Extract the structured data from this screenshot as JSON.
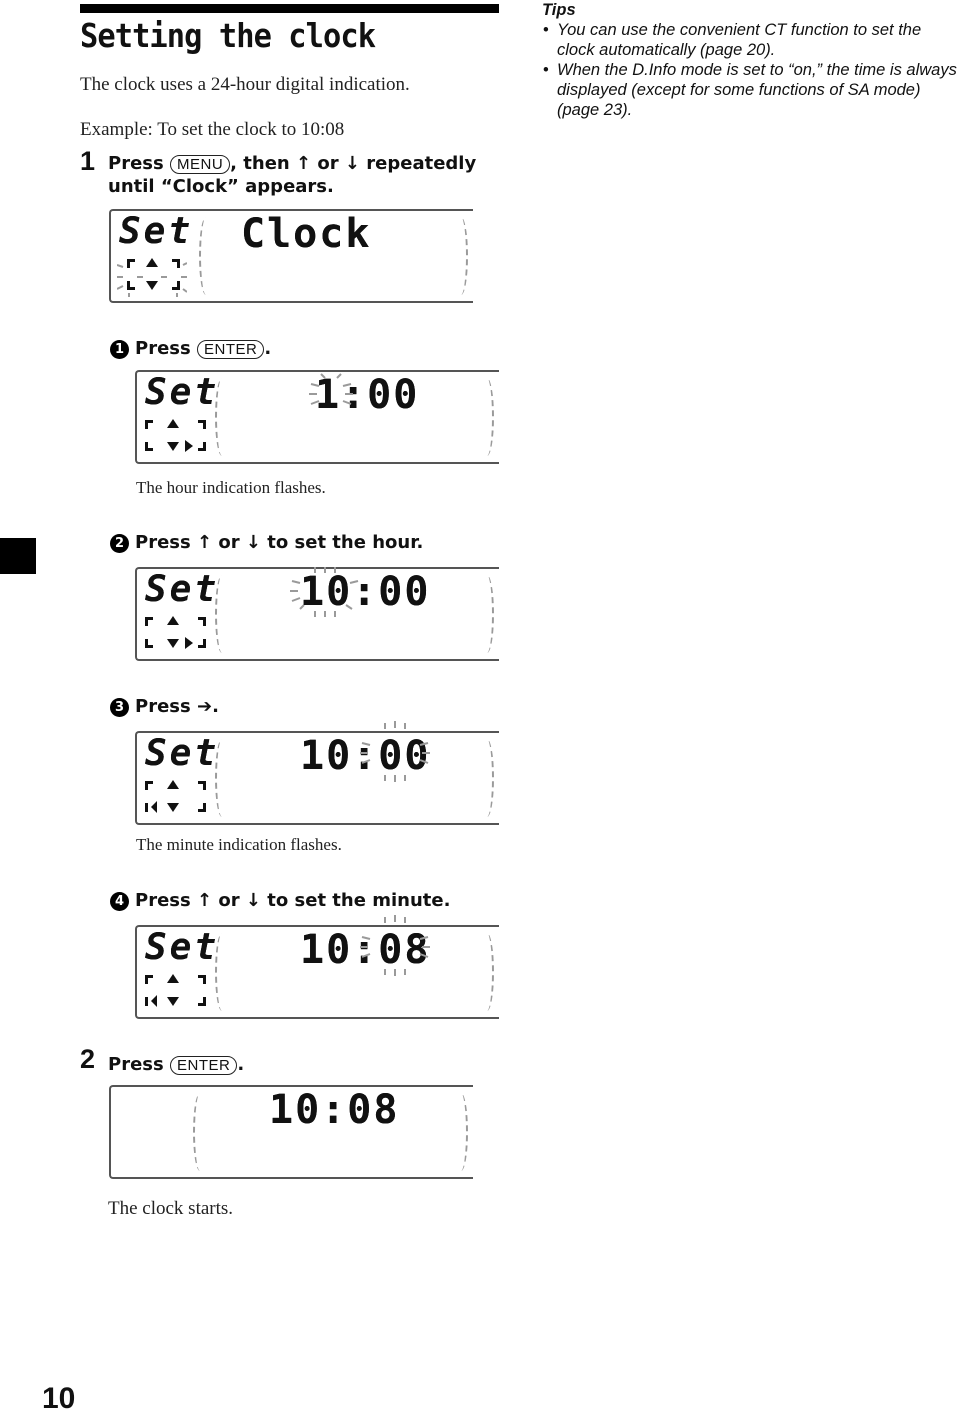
{
  "page": {
    "title": "Setting the clock",
    "intro": "The clock uses a 24-hour digital indication.",
    "example": "Example: To set the clock to 10:08",
    "page_number": "10"
  },
  "tips": {
    "title": "Tips",
    "items": [
      "You can use the convenient CT function to set the clock automatically (page 20).",
      "When the D.Info mode is set to “on,” the time is always displayed (except for some functions of SA mode) (page 23)."
    ]
  },
  "step1": {
    "number": "1",
    "press": "Press",
    "key": "MENU",
    "then": ", then",
    "up_arrow": "↑",
    "or": "or",
    "down_arrow": "↓",
    "rest": "repeatedly",
    "line2": "until “Clock” appears.",
    "display": {
      "left": "Set",
      "main": "Clock",
      "flashing": "cursor-icon"
    }
  },
  "substeps": [
    {
      "marker": "1",
      "text_before": "Press",
      "key": "ENTER",
      "text_after": ".",
      "display": {
        "left": "Set",
        "main": "1:00",
        "flashing": "hour"
      },
      "note": "The hour indication flashes."
    },
    {
      "marker": "2",
      "text_before": "Press",
      "up_arrow": "↑",
      "or": "or",
      "down_arrow": "↓",
      "text_after": "to set the hour.",
      "display": {
        "left": "Set",
        "main": "10:00",
        "flashing": "hour"
      },
      "note": ""
    },
    {
      "marker": "3",
      "text_before": "Press",
      "right_arrow": "➔",
      "text_after": ".",
      "display": {
        "left": "Set",
        "main": "10:00",
        "flashing": "minute"
      },
      "note": "The minute indication flashes."
    },
    {
      "marker": "4",
      "text_before": "Press",
      "up_arrow": "↑",
      "or": "or",
      "down_arrow": "↓",
      "text_after": "to set the minute.",
      "display": {
        "left": "Set",
        "main": "10:08",
        "flashing": "minute"
      },
      "note": ""
    }
  ],
  "step2": {
    "number": "2",
    "press": "Press",
    "key": "ENTER",
    "after": ".",
    "display": {
      "main": "10:08"
    },
    "note": "The clock starts."
  }
}
